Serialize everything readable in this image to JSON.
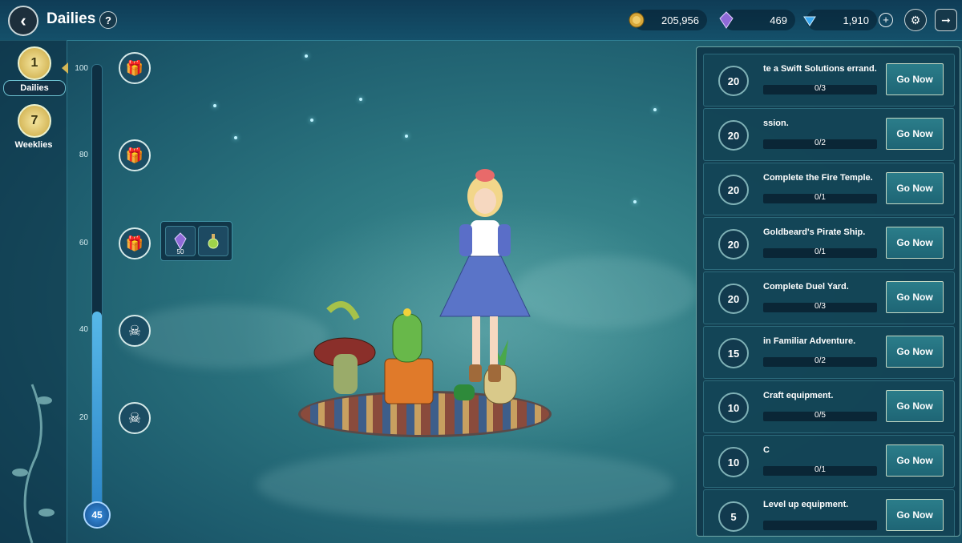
{
  "header": {
    "title": "Dailies",
    "back_icon": "back-arrow-icon",
    "help_label": "?",
    "gold": "205,956",
    "crystals": "469",
    "gems": "1,910",
    "plus_label": "+"
  },
  "sidebar": {
    "tabs": [
      {
        "label": "Dailies",
        "number": "1",
        "active": true
      },
      {
        "label": "Weeklies",
        "number": "7",
        "active": false
      }
    ]
  },
  "progress": {
    "ticks": [
      "100",
      "80",
      "60",
      "40",
      "20"
    ],
    "current": "45",
    "max": 100
  },
  "reward_popup": {
    "items": [
      {
        "icon": "crystal-icon",
        "quantity": "50"
      },
      {
        "icon": "potion-icon",
        "quantity": ""
      }
    ]
  },
  "quests": [
    {
      "points": "20",
      "desc": "te a Swift Solutions errand.",
      "count": "0/3"
    },
    {
      "points": "20",
      "desc": "ssion.",
      "count": "0/2"
    },
    {
      "points": "20",
      "desc": "Complete the Fire Temple.",
      "count": "0/1"
    },
    {
      "points": "20",
      "desc": "Goldbeard's Pirate Ship.",
      "count": "0/1"
    },
    {
      "points": "20",
      "desc": "Complete Duel Yard.",
      "count": "0/3"
    },
    {
      "points": "15",
      "desc": "in Familiar Adventure.",
      "count": "0/2"
    },
    {
      "points": "10",
      "desc": "Craft equipment.",
      "count": "0/5"
    },
    {
      "points": "10",
      "desc": "C",
      "count": "0/1"
    },
    {
      "points": "5",
      "desc": "Level up equipment.",
      "count": ""
    }
  ],
  "go_label": "Go Now"
}
